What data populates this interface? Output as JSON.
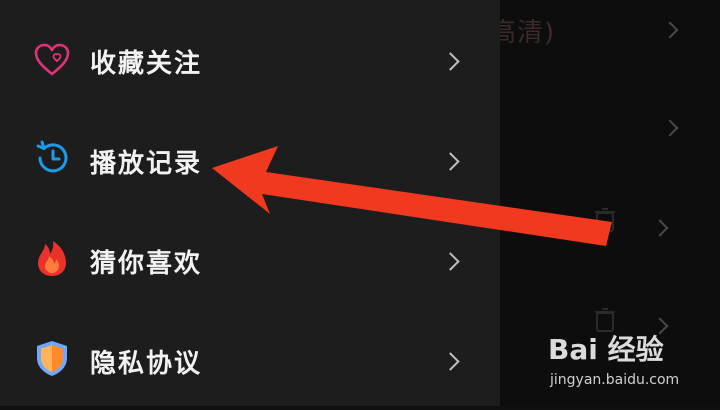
{
  "background_page": {
    "partial_title": "高清)"
  },
  "menu": {
    "items": [
      {
        "label": "收藏关注",
        "icon": "heart-outline-icon"
      },
      {
        "label": "播放记录",
        "icon": "history-clock-icon"
      },
      {
        "label": "猜你喜欢",
        "icon": "flame-icon"
      },
      {
        "label": "隐私协议",
        "icon": "shield-icon"
      }
    ]
  },
  "annotation": {
    "arrow_color": "#f0391f",
    "arrow_target": "播放记录"
  },
  "watermark": {
    "logo": "Bai 经验",
    "url": "jingyan.baidu.com"
  },
  "colors": {
    "drawer_bg": "#1d1d1d",
    "text": "#f2f2f2",
    "heart": "#e0337a",
    "clock": "#1e9be8",
    "flame": "#e8322a",
    "shield_orange": "#ff8a2a",
    "shield_blue": "#6ea8ff"
  }
}
